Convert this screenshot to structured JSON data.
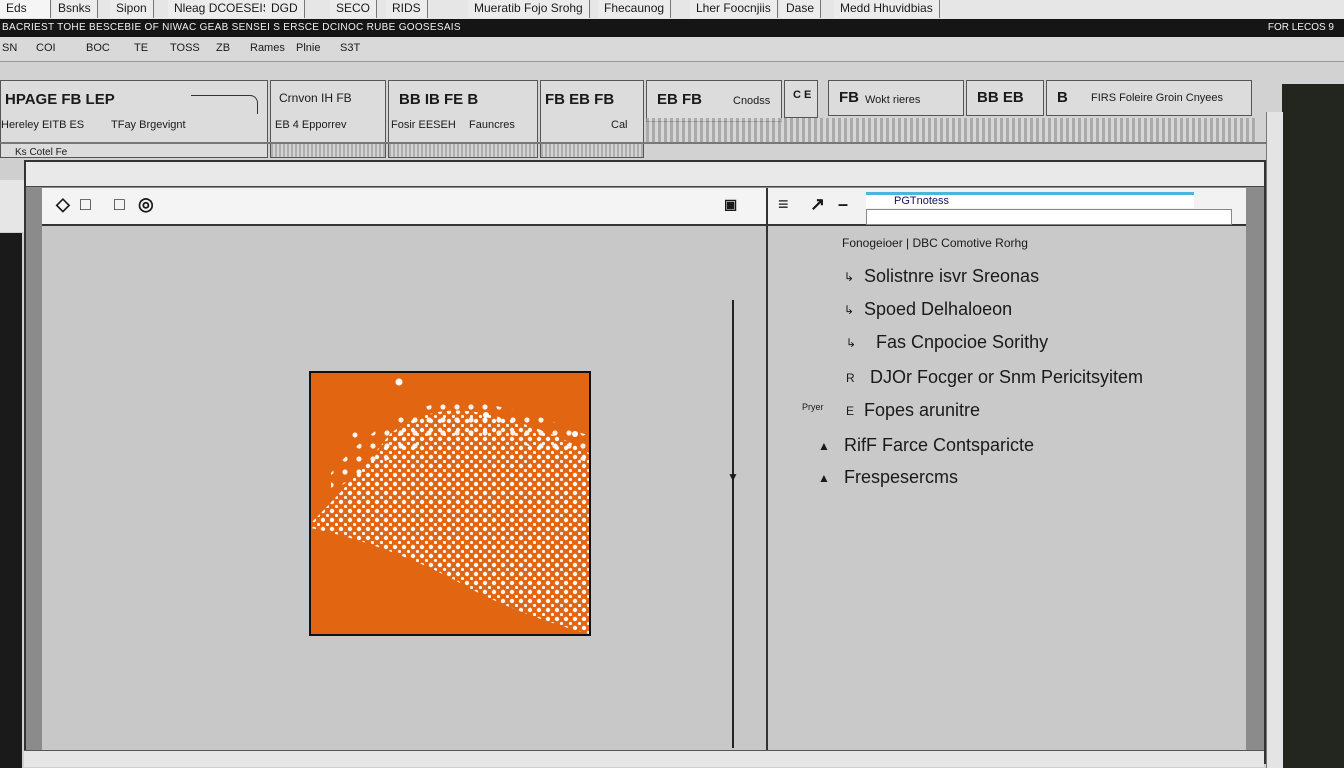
{
  "tabs": [
    "Eds",
    "Bsnks",
    "Sipon",
    "Nleag DCOESEIS",
    "DGD",
    "SECO",
    "RIDS",
    "Mueratib Fojo Srohg",
    "Fhecaunog",
    "Lher Foocnjiis",
    "Dase",
    "Medd Hhuvidbias"
  ],
  "titlebar": {
    "left": "BACRIEST TOHE BESCEBIE OF NIWAC GEAB SENSEI S  ERSCE DCINOC RUBE GOOSESAIS",
    "right": "FOR LECOS 9"
  },
  "menu": [
    "SN",
    "COI",
    "BOC",
    "TE",
    "TOSS",
    "ZB",
    "Rames",
    "Plnie",
    "S3T"
  ],
  "ribbon": {
    "groups": [
      {
        "icons": "HPAGE  FB   LEP",
        "labels": [
          "Hereley EITB  ES",
          "TFay Brgevignt"
        ],
        "sub": "Ks Cotel Fe"
      },
      {
        "icons": "Crnvon  IH  FB",
        "labels": [
          "EB 4 Epporrev"
        ]
      },
      {
        "icons": "BB  IB  FE  B",
        "labels": [
          "Fosir EESEH",
          "Fauncres"
        ]
      },
      {
        "icons": "FB  EB  FB",
        "labels": [
          "Cal"
        ]
      },
      {
        "icons": "EB FB",
        "labels": [
          "Cnodss"
        ]
      },
      {
        "icons": "C E",
        "labels": []
      },
      {
        "icons": "FB",
        "labels": [
          "Wokt rieres"
        ]
      },
      {
        "icons": "BB  EB",
        "labels": []
      },
      {
        "icons": "B",
        "labels": [
          "FIRS Foleire Groin Cnyees"
        ]
      }
    ]
  },
  "left_toolbar": [
    "◇",
    "□",
    "□",
    "◎"
  ],
  "left_toolbar_right": "▣",
  "right_toolbar": [
    "≡",
    "↗",
    "–"
  ],
  "search_value": "PGTnotess",
  "tree": {
    "header": "Fonogeioer | DBC Comotive Rorhg",
    "items": [
      {
        "label": "Solistnre isvr Sreonas",
        "marker": "↳"
      },
      {
        "label": "Spoed Delhaloeon",
        "marker": "↳"
      },
      {
        "label": "Fas Cnpocioe Sorithy",
        "marker": "↳"
      },
      {
        "label": "DJOr Focger or Snm Pericitsyitem",
        "marker": "R"
      },
      {
        "label": "Fopes arunitre",
        "marker": "E"
      },
      {
        "label": "RifF Farce Contsparicte",
        "marker": "▲"
      },
      {
        "label": "Frespesercms",
        "marker": "▲"
      }
    ],
    "side_note": "Pryer"
  },
  "colors": {
    "accent": "#49b7d8",
    "image": "#e26512",
    "dark": "#23261f"
  }
}
